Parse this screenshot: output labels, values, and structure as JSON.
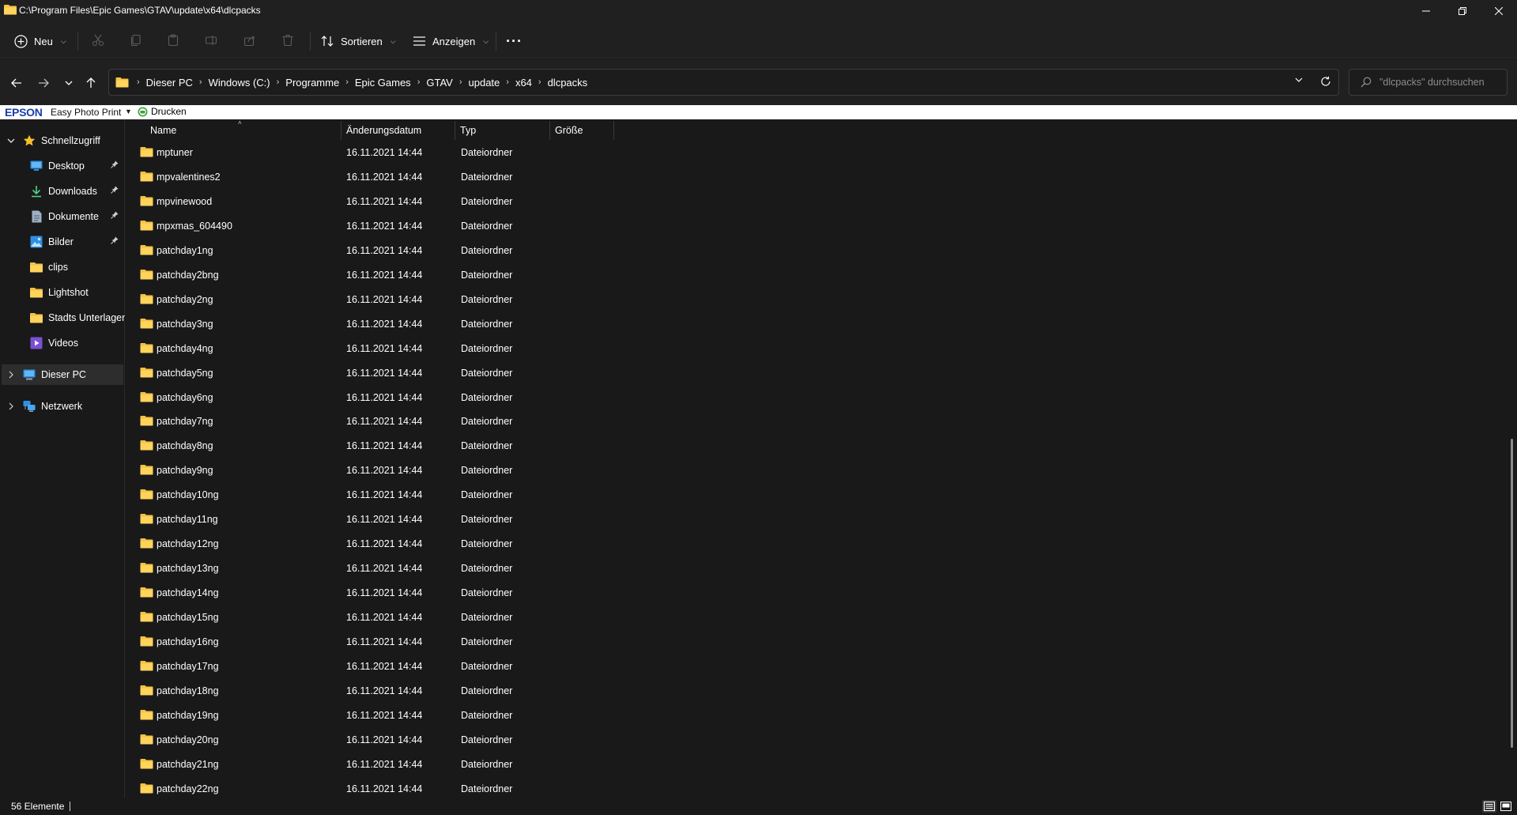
{
  "window": {
    "title": "C:\\Program Files\\Epic Games\\GTAV\\update\\x64\\dlcpacks"
  },
  "toolbar": {
    "new_label": "Neu",
    "sort_label": "Sortieren",
    "view_label": "Anzeigen",
    "more_label": "···"
  },
  "breadcrumb": [
    "Dieser PC",
    "Windows (C:)",
    "Programme",
    "Epic Games",
    "GTAV",
    "update",
    "x64",
    "dlcpacks"
  ],
  "search": {
    "placeholder": "\"dlcpacks\" durchsuchen"
  },
  "epson": {
    "brand": "EPSON",
    "app": "Easy Photo Print",
    "print": "Drucken"
  },
  "navpane": {
    "quick_access": "Schnellzugriff",
    "items": [
      {
        "label": "Desktop",
        "icon": "desktop-icon",
        "pinned": true
      },
      {
        "label": "Downloads",
        "icon": "downloads-icon",
        "pinned": true
      },
      {
        "label": "Dokumente",
        "icon": "documents-icon",
        "pinned": true
      },
      {
        "label": "Bilder",
        "icon": "pictures-icon",
        "pinned": true
      },
      {
        "label": "clips",
        "icon": "folder-icon",
        "pinned": false
      },
      {
        "label": "Lightshot",
        "icon": "folder-icon",
        "pinned": false
      },
      {
        "label": "Stadts Unterlagen",
        "icon": "folder-icon",
        "pinned": false
      },
      {
        "label": "Videos",
        "icon": "videos-icon",
        "pinned": false
      }
    ],
    "this_pc": "Dieser PC",
    "network": "Netzwerk"
  },
  "columns": {
    "name": "Name",
    "date": "Änderungsdatum",
    "type": "Typ",
    "size": "Größe"
  },
  "files": [
    {
      "name": "mptuner",
      "date": "16.11.2021 14:44",
      "type": "Dateiordner"
    },
    {
      "name": "mpvalentines2",
      "date": "16.11.2021 14:44",
      "type": "Dateiordner"
    },
    {
      "name": "mpvinewood",
      "date": "16.11.2021 14:44",
      "type": "Dateiordner"
    },
    {
      "name": "mpxmas_604490",
      "date": "16.11.2021 14:44",
      "type": "Dateiordner"
    },
    {
      "name": "patchday1ng",
      "date": "16.11.2021 14:44",
      "type": "Dateiordner"
    },
    {
      "name": "patchday2bng",
      "date": "16.11.2021 14:44",
      "type": "Dateiordner"
    },
    {
      "name": "patchday2ng",
      "date": "16.11.2021 14:44",
      "type": "Dateiordner"
    },
    {
      "name": "patchday3ng",
      "date": "16.11.2021 14:44",
      "type": "Dateiordner"
    },
    {
      "name": "patchday4ng",
      "date": "16.11.2021 14:44",
      "type": "Dateiordner"
    },
    {
      "name": "patchday5ng",
      "date": "16.11.2021 14:44",
      "type": "Dateiordner"
    },
    {
      "name": "patchday6ng",
      "date": "16.11.2021 14:44",
      "type": "Dateiordner"
    },
    {
      "name": "patchday7ng",
      "date": "16.11.2021 14:44",
      "type": "Dateiordner"
    },
    {
      "name": "patchday8ng",
      "date": "16.11.2021 14:44",
      "type": "Dateiordner"
    },
    {
      "name": "patchday9ng",
      "date": "16.11.2021 14:44",
      "type": "Dateiordner"
    },
    {
      "name": "patchday10ng",
      "date": "16.11.2021 14:44",
      "type": "Dateiordner"
    },
    {
      "name": "patchday11ng",
      "date": "16.11.2021 14:44",
      "type": "Dateiordner"
    },
    {
      "name": "patchday12ng",
      "date": "16.11.2021 14:44",
      "type": "Dateiordner"
    },
    {
      "name": "patchday13ng",
      "date": "16.11.2021 14:44",
      "type": "Dateiordner"
    },
    {
      "name": "patchday14ng",
      "date": "16.11.2021 14:44",
      "type": "Dateiordner"
    },
    {
      "name": "patchday15ng",
      "date": "16.11.2021 14:44",
      "type": "Dateiordner"
    },
    {
      "name": "patchday16ng",
      "date": "16.11.2021 14:44",
      "type": "Dateiordner"
    },
    {
      "name": "patchday17ng",
      "date": "16.11.2021 14:44",
      "type": "Dateiordner"
    },
    {
      "name": "patchday18ng",
      "date": "16.11.2021 14:44",
      "type": "Dateiordner"
    },
    {
      "name": "patchday19ng",
      "date": "16.11.2021 14:44",
      "type": "Dateiordner"
    },
    {
      "name": "patchday20ng",
      "date": "16.11.2021 14:44",
      "type": "Dateiordner"
    },
    {
      "name": "patchday21ng",
      "date": "16.11.2021 14:44",
      "type": "Dateiordner"
    },
    {
      "name": "patchday22ng",
      "date": "16.11.2021 14:44",
      "type": "Dateiordner"
    }
  ],
  "status": {
    "count": "56 Elemente"
  },
  "colors": {
    "background": "#191919",
    "chrome": "#202020",
    "folder": "#f4c244",
    "accent": "#60cdff"
  }
}
